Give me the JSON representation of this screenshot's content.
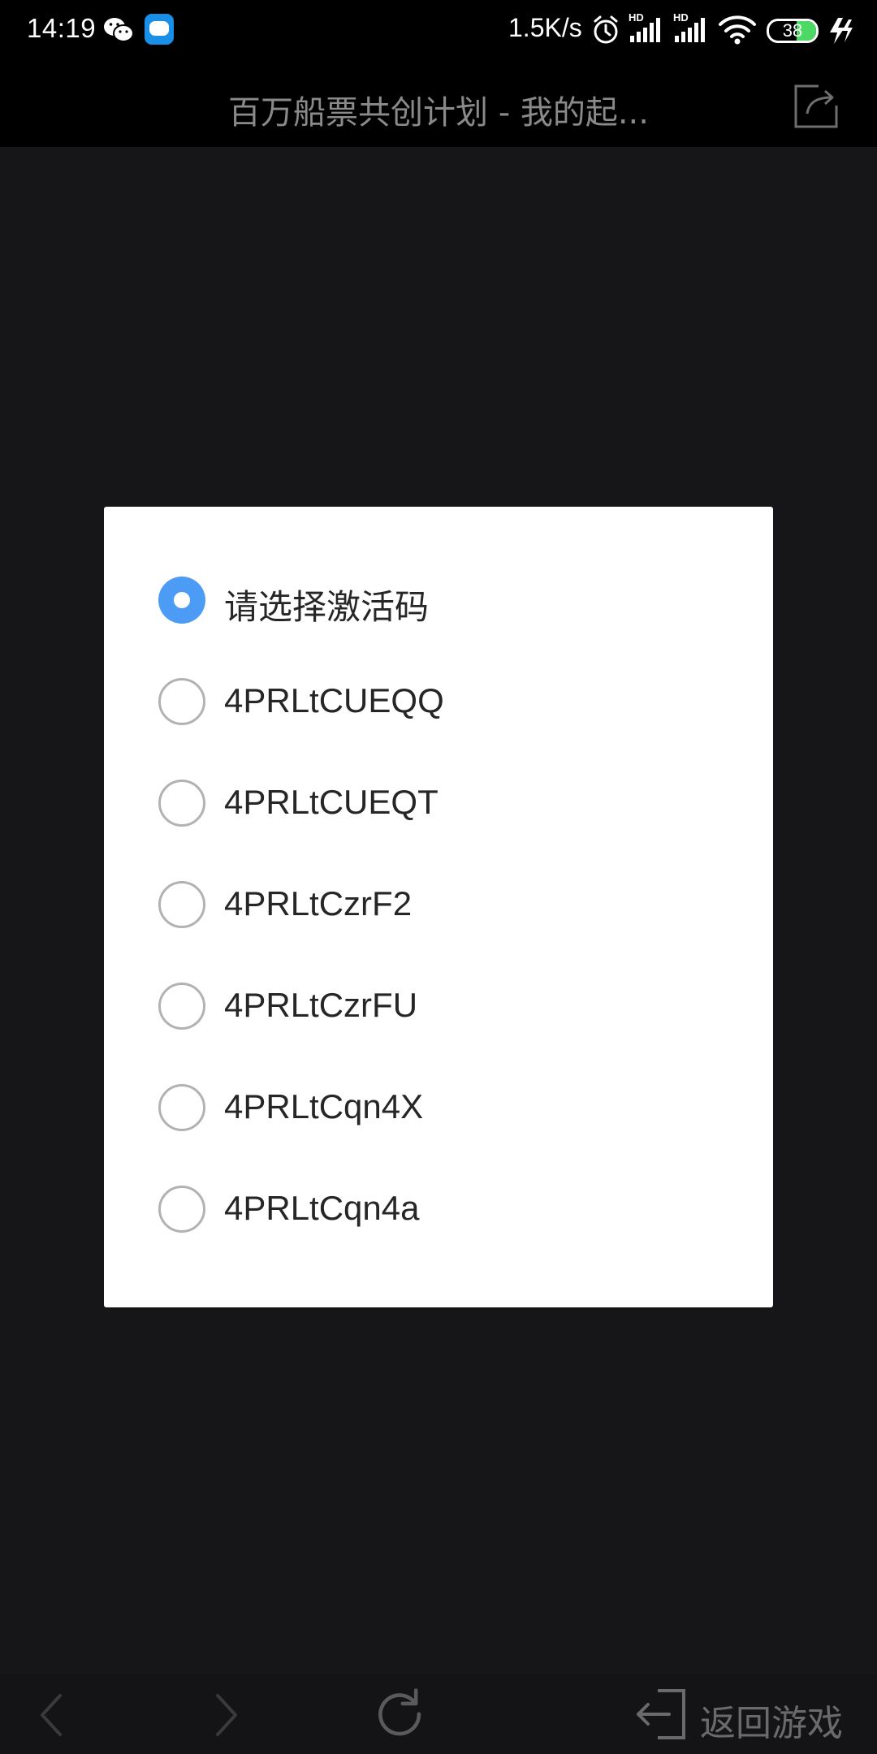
{
  "status_bar": {
    "time": "14:19",
    "network_speed": "1.5K/s",
    "battery_level": "38",
    "signal_tag_1": "HD",
    "signal_tag_2": "HD",
    "icons": [
      "wechat-icon",
      "app-notification-icon",
      "alarm-icon",
      "signal-icon",
      "wifi-icon",
      "battery-icon",
      "charging-icon"
    ]
  },
  "title_bar": {
    "title": "百万船票共创计划 - 我的起...",
    "share_icon": "share-icon"
  },
  "dialog": {
    "selected_index": 0,
    "options": [
      {
        "label": "请选择激活码"
      },
      {
        "label": "4PRLtCUEQQ"
      },
      {
        "label": "4PRLtCUEQT"
      },
      {
        "label": "4PRLtCzrF2"
      },
      {
        "label": "4PRLtCzrFU"
      },
      {
        "label": "4PRLtCqn4X"
      },
      {
        "label": "4PRLtCqn4a"
      }
    ],
    "accent_color": "#4c9cf5"
  },
  "bottom_nav": {
    "back_icon": "chevron-left-icon",
    "forward_icon": "chevron-right-icon",
    "refresh_icon": "refresh-icon",
    "back_to_game_icon": "exit-icon",
    "back_to_game_label": "返回游戏"
  }
}
